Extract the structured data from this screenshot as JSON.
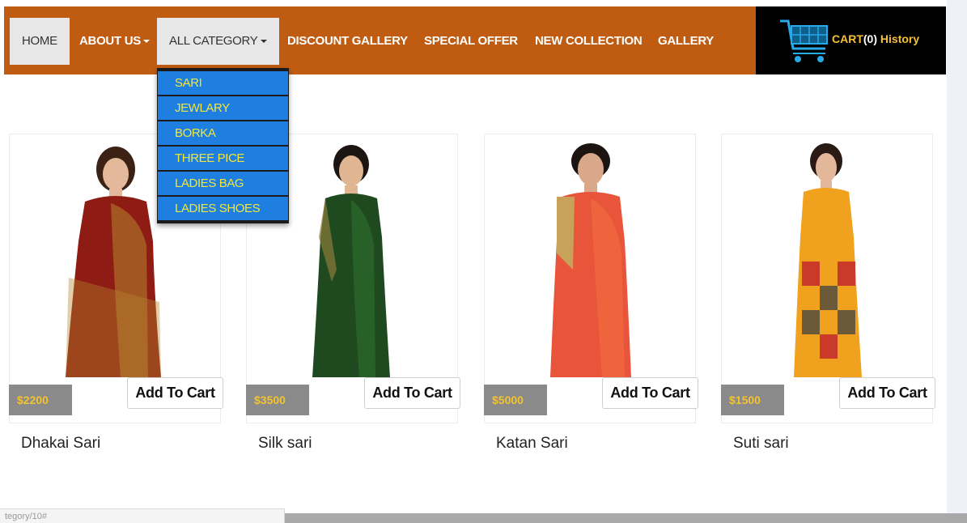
{
  "nav": {
    "items": [
      {
        "label": "HOME"
      },
      {
        "label": "ABOUT US"
      },
      {
        "label": "ALL CATEGORY"
      },
      {
        "label": "DISCOUNT GALLERY"
      },
      {
        "label": "SPECIAL OFFER"
      },
      {
        "label": "NEW COLLECTION"
      },
      {
        "label": "GALLERY"
      }
    ],
    "brand_color": "#bf5c12"
  },
  "dropdown": {
    "items": [
      "SARI",
      "JEWLARY",
      "BORKA",
      "THREE PICE",
      "LADIES BAG",
      "LADIES SHOES"
    ],
    "item_bg": "#1f7fe0",
    "item_text_color": "#f2e63c"
  },
  "cart": {
    "label": "CART",
    "count": "(0)",
    "history": "History",
    "icon": "shopping-cart-icon"
  },
  "products": [
    {
      "name": "Dhakai Sari",
      "price": "$2200",
      "button": "Add To Cart"
    },
    {
      "name": "Silk sari",
      "price": "$3500",
      "button": "Add To Cart"
    },
    {
      "name": "Katan Sari",
      "price": "$5000",
      "button": "Add To Cart"
    },
    {
      "name": "Suti sari",
      "price": "$1500",
      "button": "Add To Cart"
    }
  ],
  "status_bar": {
    "url": "tegory/10#"
  }
}
